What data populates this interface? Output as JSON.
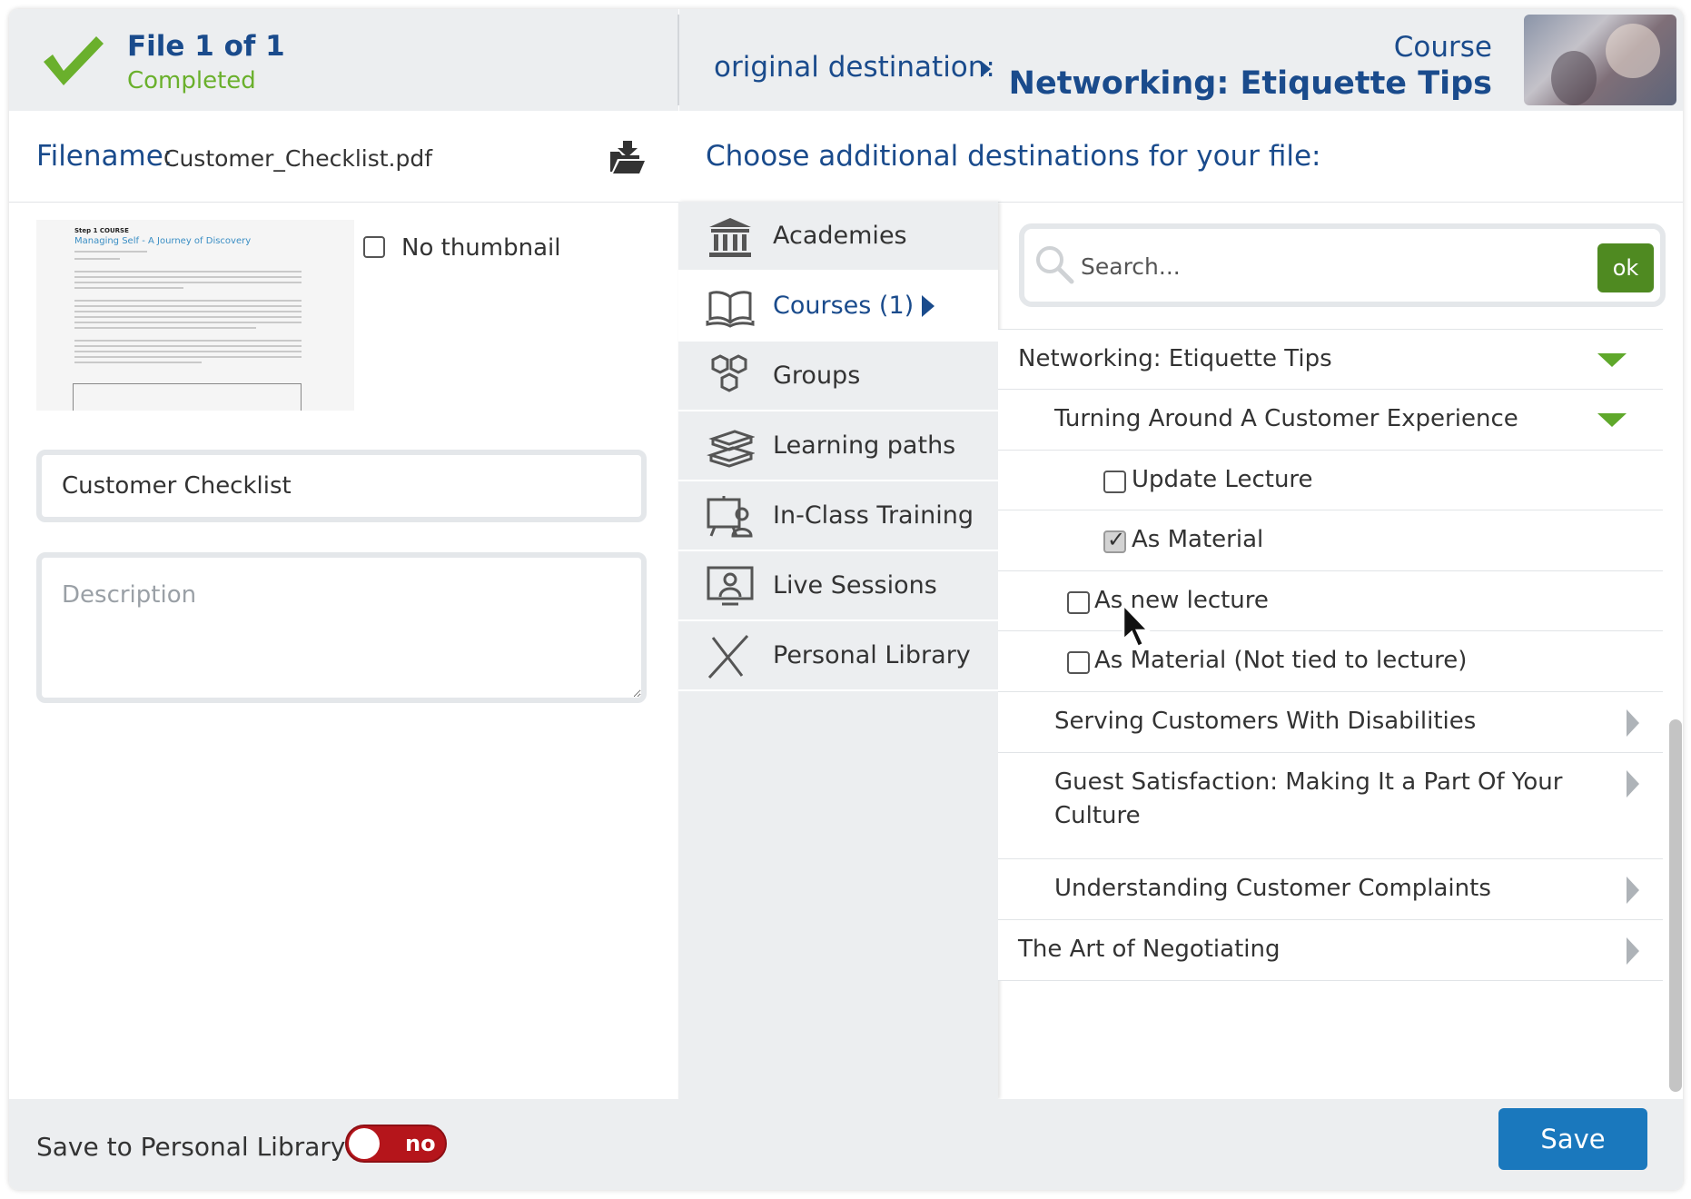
{
  "header": {
    "file_count": "File 1 of 1",
    "status": "Completed",
    "original_destination_label": "original destination:",
    "course_label": "Course",
    "course_title": "Networking: Etiquette Tips"
  },
  "file": {
    "filename_label": "Filename:",
    "filename": "Customer_Checklist.pdf",
    "no_thumbnail_label": "No thumbnail",
    "no_thumbnail_checked": false,
    "title_value": "Customer Checklist",
    "description_placeholder": "Description"
  },
  "document_preview": {
    "heading": "Step 1 COURSE",
    "title": "Managing Self - A Journey of Discovery"
  },
  "destinations": {
    "heading": "Choose additional destinations for your file:",
    "nav": [
      {
        "label": "Academies",
        "icon": "academy-icon",
        "active": false
      },
      {
        "label": "Courses (1)",
        "icon": "open-book-icon",
        "active": true
      },
      {
        "label": "Groups",
        "icon": "groups-icon",
        "active": false
      },
      {
        "label": "Learning paths",
        "icon": "stacked-books-icon",
        "active": false
      },
      {
        "label": "In-Class Training",
        "icon": "classroom-icon",
        "active": false
      },
      {
        "label": "Live Sessions",
        "icon": "live-session-icon",
        "active": false
      },
      {
        "label": "Personal Library",
        "icon": "personal-library-icon",
        "active": false
      }
    ]
  },
  "search": {
    "placeholder": "Search...",
    "ok_label": "ok"
  },
  "tree": [
    {
      "label": "Networking: Etiquette Tips",
      "type": "course",
      "state": "expanded"
    },
    {
      "label": "Turning Around A Customer Experience",
      "type": "lecture",
      "state": "expanded"
    },
    {
      "label": "Update Lecture",
      "type": "option",
      "checked": false
    },
    {
      "label": "As Material",
      "type": "option",
      "checked": true
    },
    {
      "label": "As new lecture",
      "type": "option",
      "checked": false
    },
    {
      "label": "As Material (Not tied to lecture)",
      "type": "option",
      "checked": false
    },
    {
      "label": "Serving Customers With Disabilities",
      "type": "lecture",
      "state": "collapsed"
    },
    {
      "label": "Guest Satisfaction: Making It a Part Of Your Culture",
      "type": "lecture",
      "state": "collapsed"
    },
    {
      "label": "Understanding Customer Complaints",
      "type": "lecture",
      "state": "collapsed"
    },
    {
      "label": "The Art of Negotiating",
      "type": "course",
      "state": "collapsed"
    }
  ],
  "footer": {
    "save_personal_library_label": "Save to Personal Library",
    "toggle_label": "no",
    "save_label": "Save"
  },
  "colors": {
    "brand_blue": "#1a4b8c",
    "success_green": "#6ab02c",
    "ok_green": "#4f8a21",
    "toggle_red": "#b5151b",
    "save_blue": "#1a78bd"
  }
}
